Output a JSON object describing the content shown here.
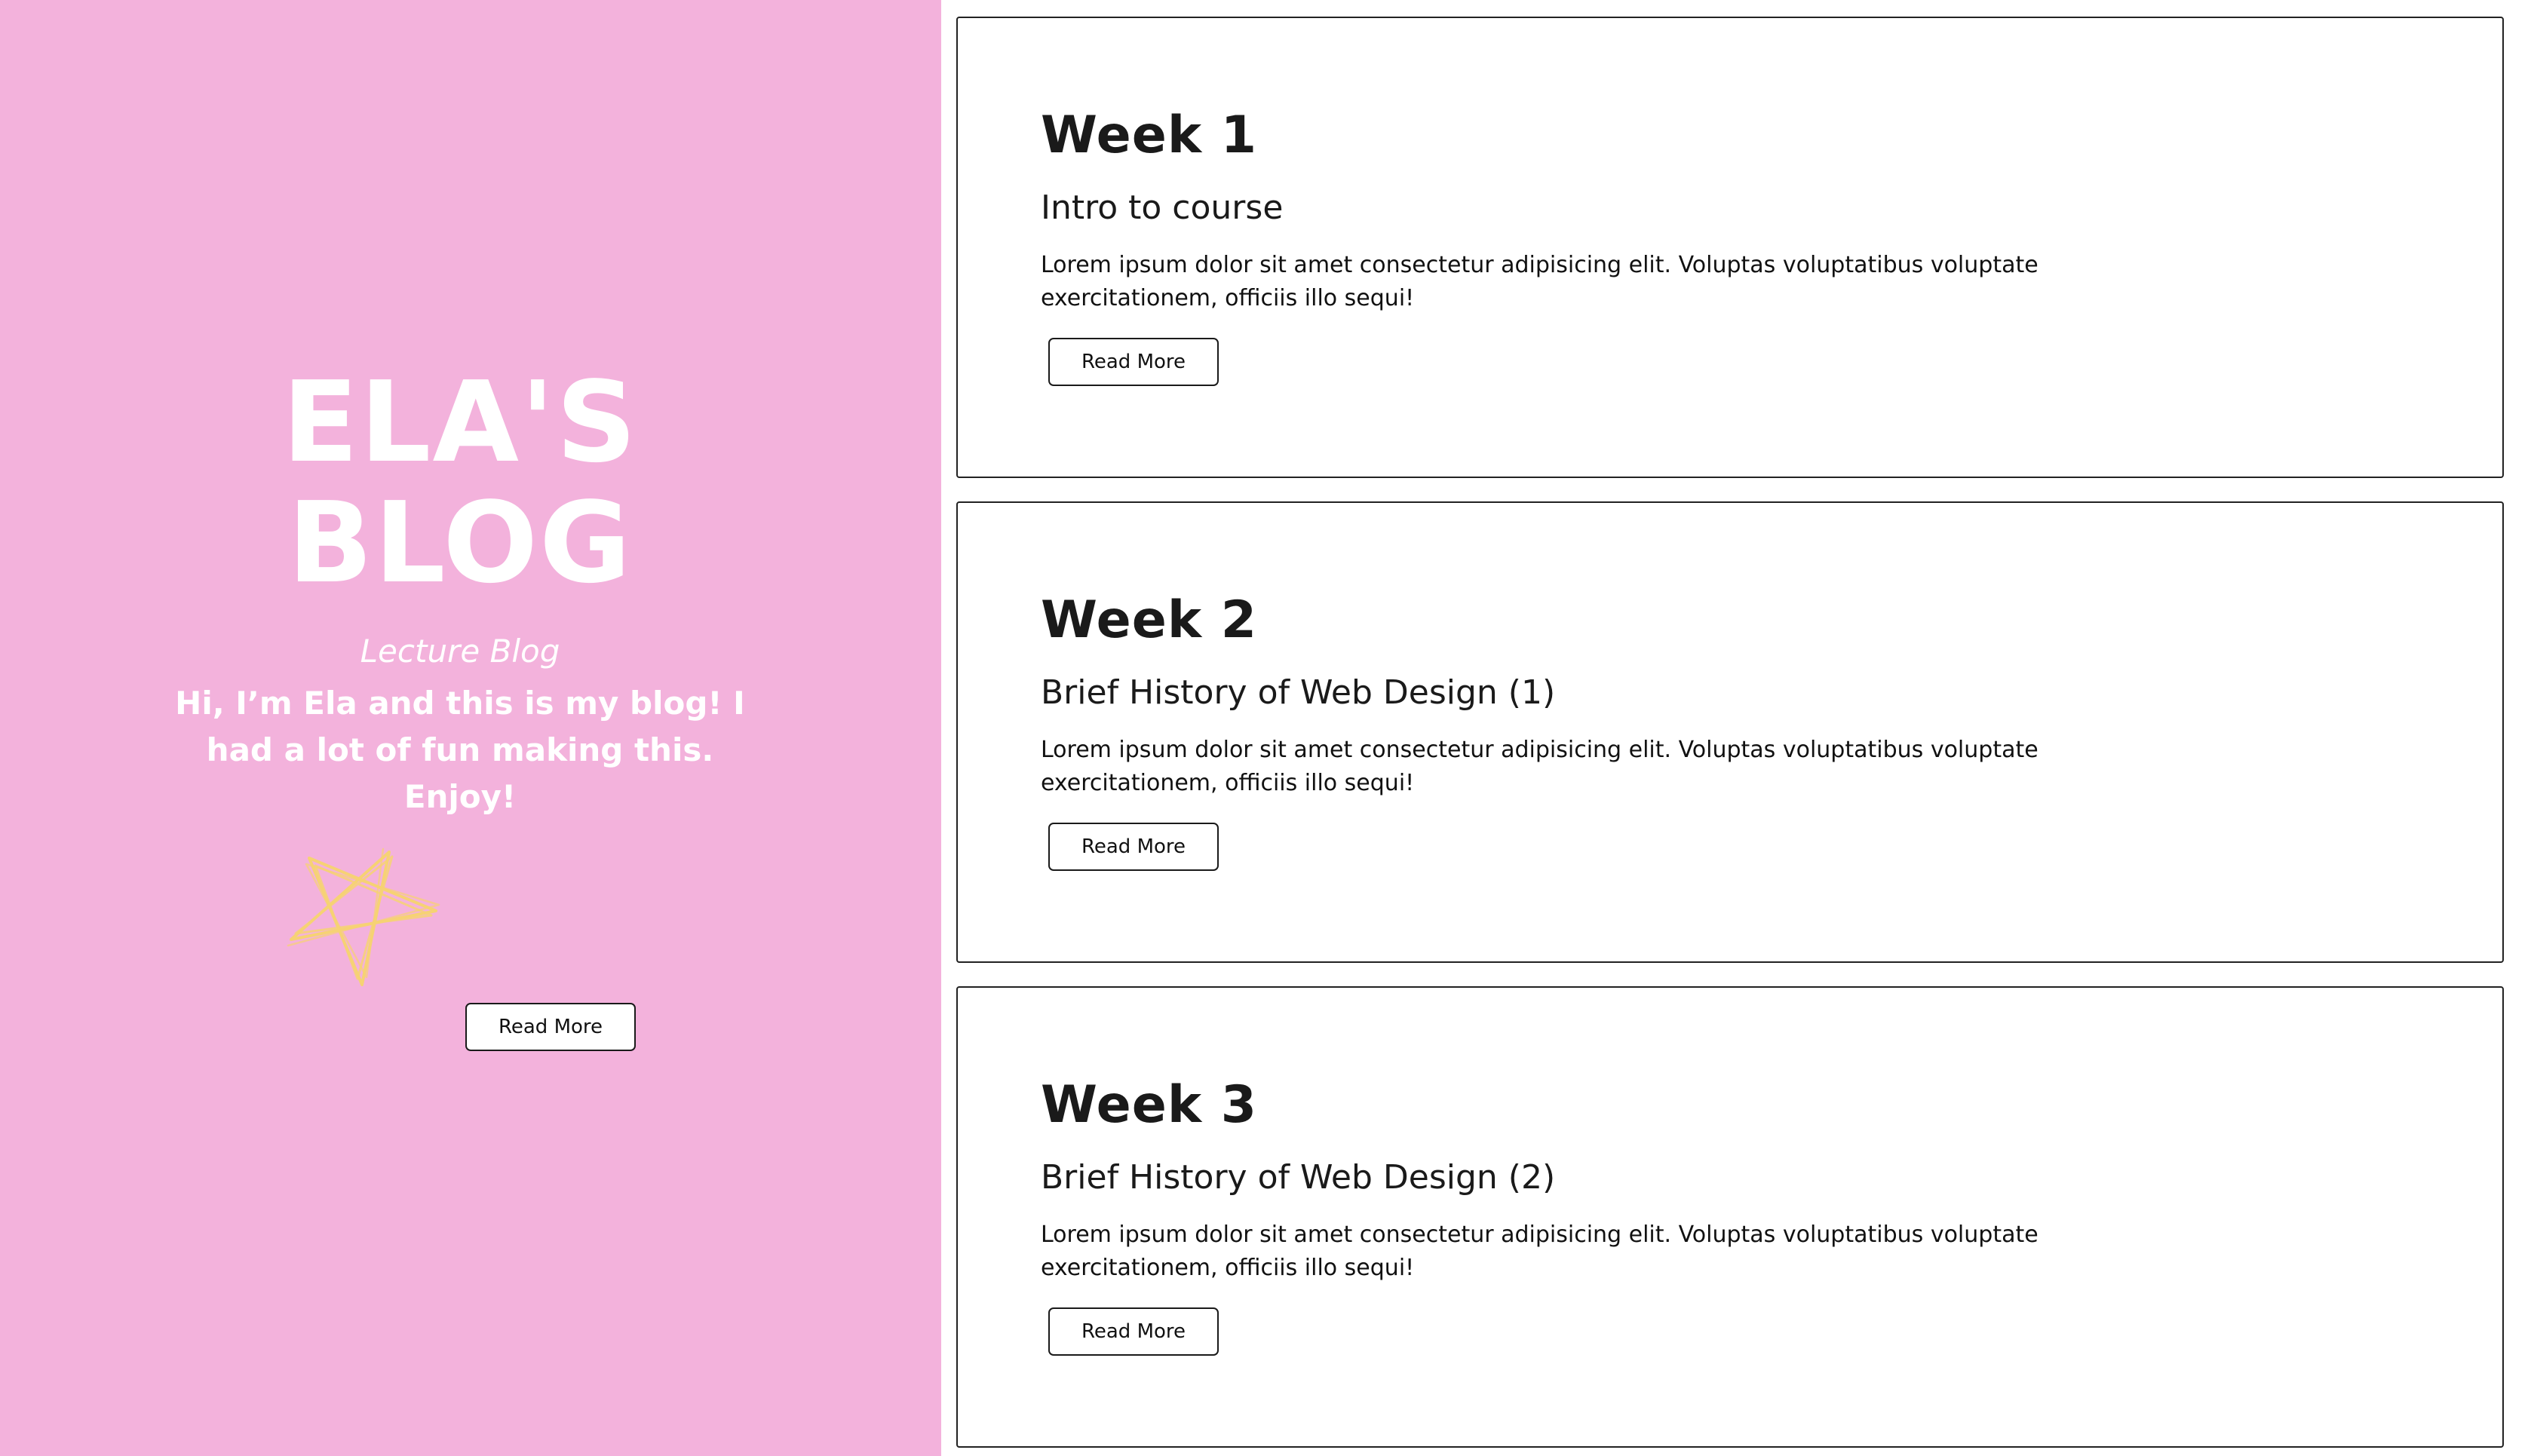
{
  "colors": {
    "hero_background": "#f3b2dc",
    "hero_text": "#ffffff",
    "star_stroke": "#f6d274",
    "card_border": "#222222",
    "text_dark": "#1a1a1a"
  },
  "hero": {
    "title_line1": "ELA'S",
    "title_line2": "BLOG",
    "subtitle": "Lecture Blog",
    "intro": "Hi, I’m Ela and this is my blog! I had a lot of fun making this. Enjoy!",
    "decoration_icon": "star-icon",
    "button_label": "Read More"
  },
  "posts": [
    {
      "week": "Week 1",
      "title": "Intro to course",
      "excerpt": "Lorem ipsum dolor sit amet consectetur adipisicing elit. Voluptas voluptatibus voluptate exercitationem, officiis illo sequi!",
      "button_label": "Read More"
    },
    {
      "week": "Week 2",
      "title": "Brief History of Web Design (1)",
      "excerpt": "Lorem ipsum dolor sit amet consectetur adipisicing elit. Voluptas voluptatibus voluptate exercitationem, officiis illo sequi!",
      "button_label": "Read More"
    },
    {
      "week": "Week 3",
      "title": "Brief History of Web Design (2)",
      "excerpt": "Lorem ipsum dolor sit amet consectetur adipisicing elit. Voluptas voluptatibus voluptate exercitationem, officiis illo sequi!",
      "button_label": "Read More"
    }
  ]
}
